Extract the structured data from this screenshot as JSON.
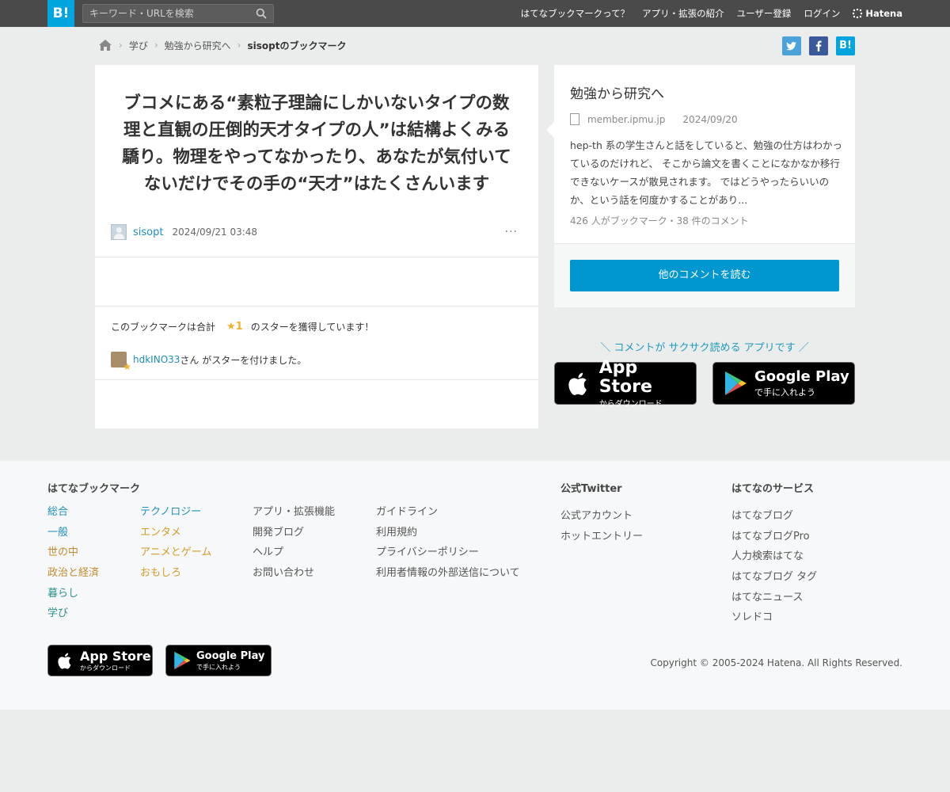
{
  "header": {
    "logo": "B!",
    "search_placeholder": "キーワード・URLを検索",
    "nav": [
      "はてなブックマークって？",
      "アプリ・拡張の紹介",
      "ユーザー登録",
      "ログイン"
    ],
    "brand": "Hatena"
  },
  "breadcrumb": {
    "items": [
      "学び",
      "勉強から研究へ"
    ],
    "current": "sisoptのブックマーク"
  },
  "share": [
    "twitter-icon",
    "facebook-icon",
    "hatena-bookmark-icon"
  ],
  "bookmark": {
    "comment": "ブコメにある“素粒子理論にしかいないタイプの数理と直観の圧倒的天才タイプの人”は結構よくみる驕り。物理をやってなかったり、あなたが気付いてないだけでその手の“天才”はたくさんいます",
    "user": "sisopt",
    "date": "2024/09/21 03:48",
    "more": "···",
    "star_text_before": "このブックマークは合計",
    "star_count": "★1",
    "star_text_after": "のスターを獲得しています！",
    "star_user": "hdkINO33",
    "star_user_suffix": "さん がスターを付けました。"
  },
  "entry": {
    "title": "勉強から研究へ",
    "domain": "member.ipmu.jp",
    "date": "2024/09/20",
    "description": "hep-th 系の学生さんと話をしていると、勉強の仕方はわかっているのだけれど、 そこから論文を書くことになかなか移行できないケースが散見されます。 ではどうやったらいいのか、という話を何度かすることがあり...",
    "stats": "426 人がブックマーク・38 件のコメント",
    "button": "他のコメントを読む"
  },
  "promo": {
    "text": "＼ コメントが サクサク読める アプリです ／",
    "appstore_big": "App Store",
    "appstore_small": "からダウンロード",
    "googleplay_big": "Google Play",
    "googleplay_small": "で手に入れよう"
  },
  "footer": {
    "col1_title": "はてなブックマーク",
    "col1": [
      "総合",
      "一般",
      "世の中",
      "政治と経済",
      "暮らし",
      "学び"
    ],
    "col2": [
      "テクノロジー",
      "エンタメ",
      "アニメとゲーム",
      "おもしろ"
    ],
    "col3": [
      "アプリ・拡張機能",
      "開発ブログ",
      "ヘルプ",
      "お問い合わせ"
    ],
    "col4": [
      "ガイドライン",
      "利用規約",
      "プライバシーポリシー",
      "利用者情報の外部送信について"
    ],
    "twitter_title": "公式Twitter",
    "twitter": [
      "公式アカウント",
      "ホットエントリー"
    ],
    "services_title": "はてなのサービス",
    "services": [
      "はてなブログ",
      "はてなブログPro",
      "人力検索はてな",
      "はてなブログ タグ",
      "はてなニュース",
      "ソレドコ"
    ],
    "copyright": "Copyright © 2005-2024 Hatena. All Rights Reserved."
  },
  "colors": {
    "accent": "#00a4de",
    "button": "#0096cf",
    "star": "#f4b128"
  }
}
